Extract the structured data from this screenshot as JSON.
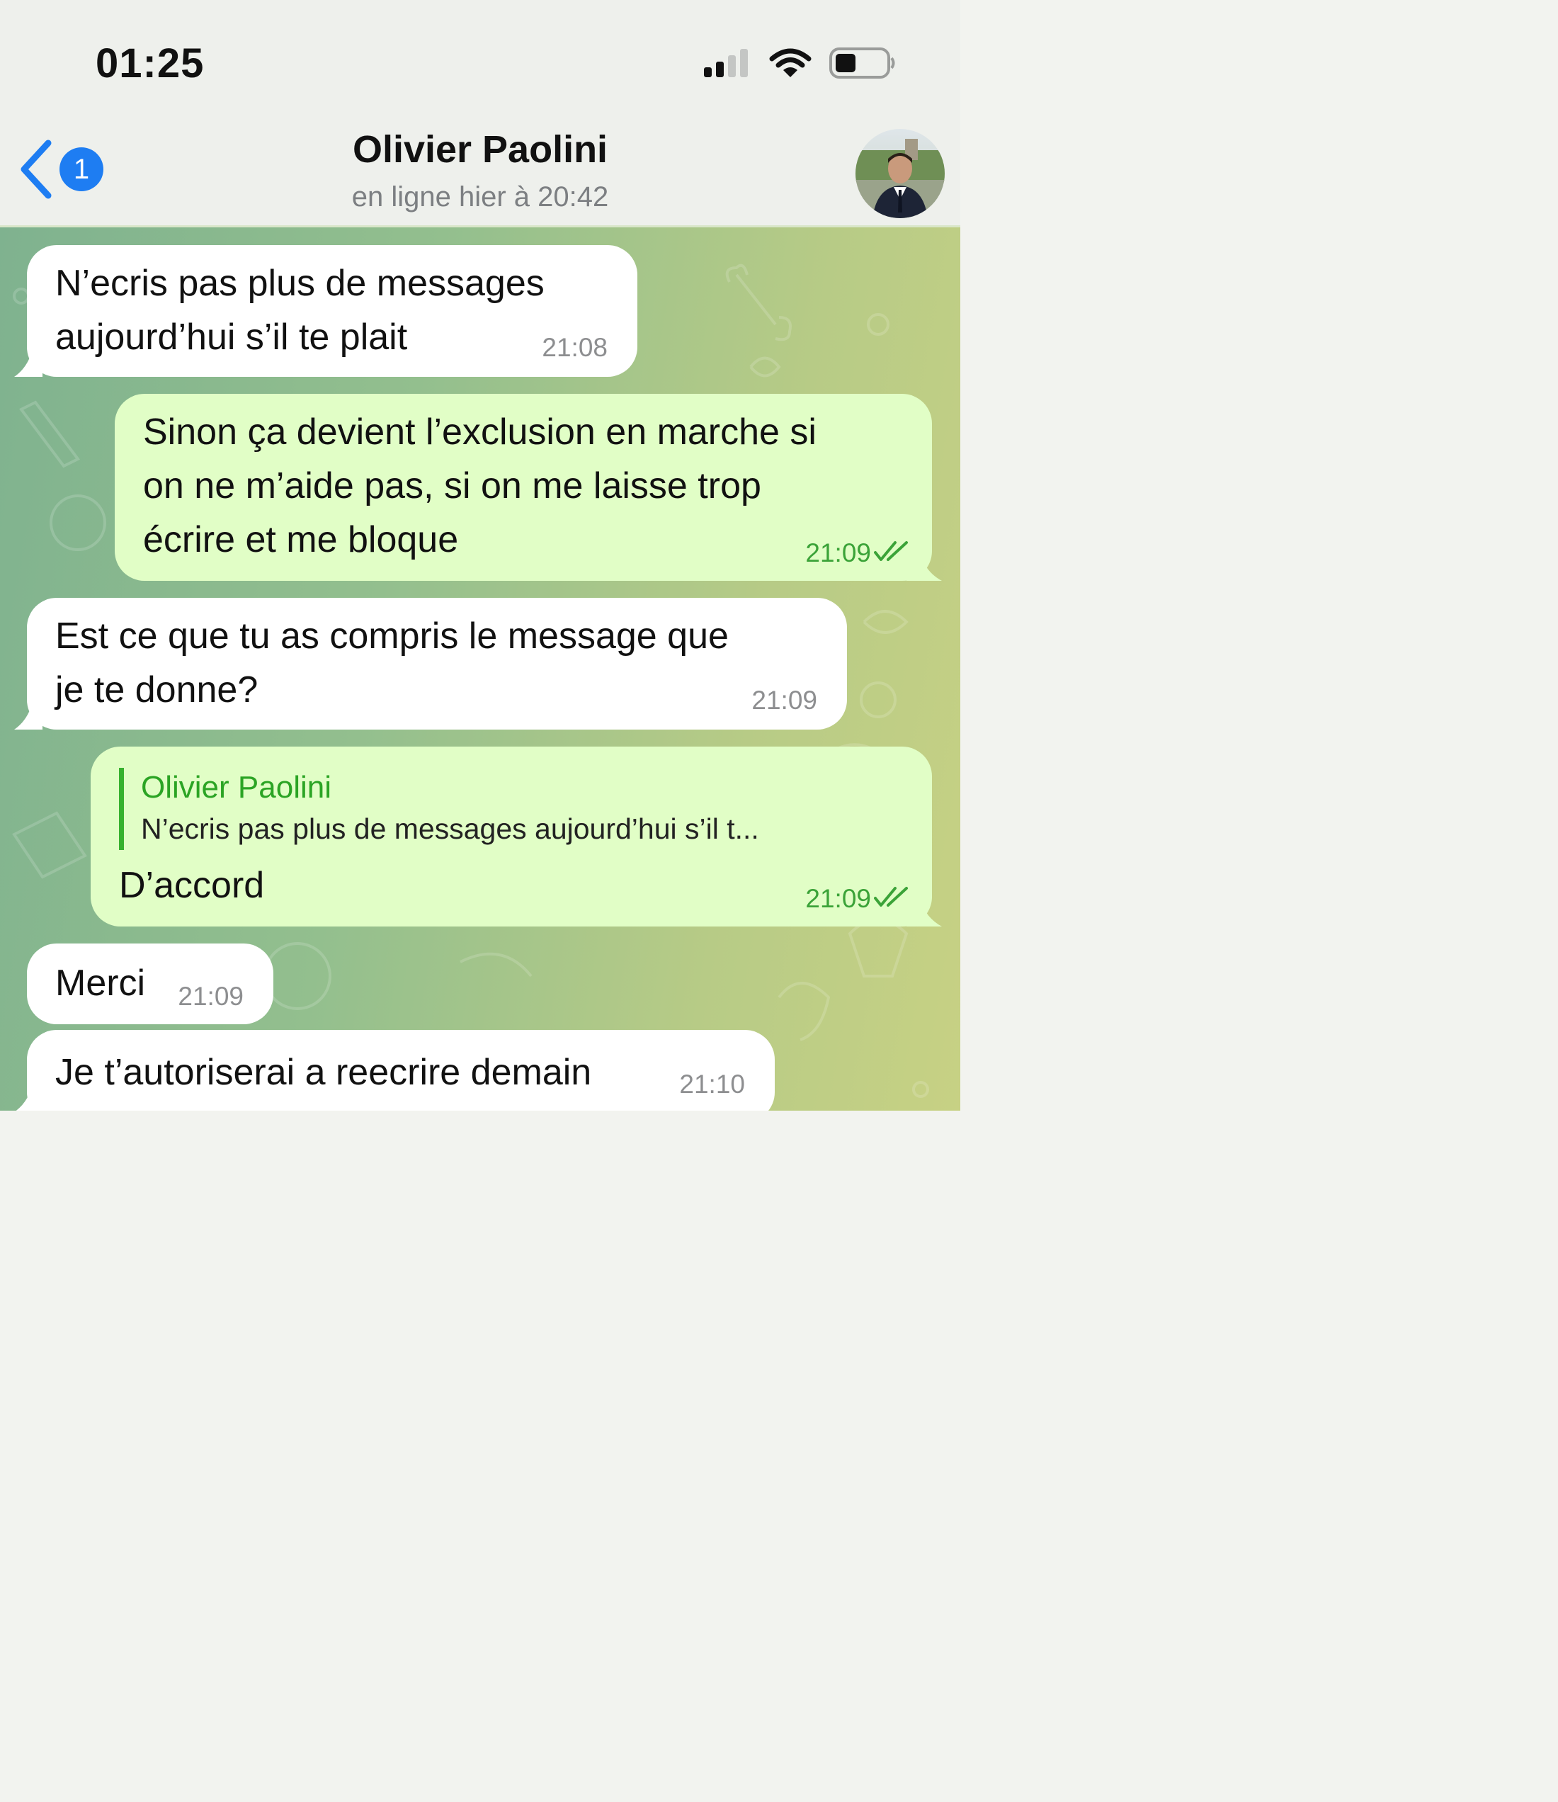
{
  "status_bar": {
    "time": "01:25"
  },
  "header": {
    "back_badge": "1",
    "contact_name": "Olivier Paolini",
    "contact_status": "en ligne hier à 20:42"
  },
  "messages": [
    {
      "dir": "in",
      "lines": [
        "N’ecris pas plus de messages",
        "aujourd’hui s’il te plait"
      ],
      "time": "21:08"
    },
    {
      "dir": "out",
      "lines": [
        "Sinon ça devient l’exclusion en marche si",
        "on ne m’aide pas, si on me laisse trop",
        "écrire et me bloque"
      ],
      "time": "21:09"
    },
    {
      "dir": "in",
      "lines": [
        "Est ce que tu as compris le message que",
        "je te donne?"
      ],
      "time": "21:09"
    },
    {
      "dir": "out",
      "reply_name": "Olivier Paolini",
      "reply_text": "N’ecris pas plus de messages aujourd’hui s’il t...",
      "text": "D’accord",
      "time": "21:09"
    },
    {
      "dir": "in",
      "text": "Merci",
      "time": "21:09"
    },
    {
      "dir": "in",
      "text": "Je t’autoriserai a reecrire demain",
      "time": "21:10"
    }
  ],
  "colors": {
    "incoming_bubble": "#ffffff",
    "outgoing_bubble": "#e1fec6",
    "outgoing_time": "#3ba338",
    "accent_blue": "#1e7df2"
  },
  "icons": [
    "chevron-left-icon",
    "signal-icon",
    "wifi-icon",
    "battery-icon",
    "read-ticks-icon"
  ]
}
